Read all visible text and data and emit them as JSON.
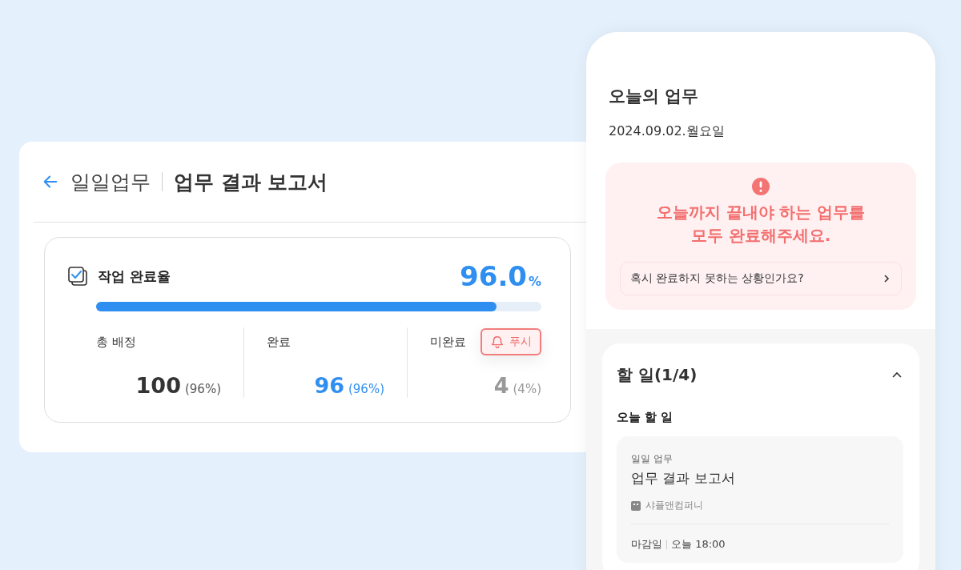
{
  "report": {
    "breadcrumb": "일일업무",
    "title": "업무 결과 보고서",
    "card": {
      "title": "작업 완료율",
      "percent": "96.0",
      "percent_unit": "%",
      "level": 0.9,
      "stats": [
        {
          "kind": "total",
          "label": "총 배정",
          "value": "100",
          "share": "(96%)"
        },
        {
          "kind": "done",
          "label": "완료",
          "value": "96",
          "share": "(96%)"
        },
        {
          "kind": "pending",
          "label": "미완료",
          "value": "4",
          "share": "(4%)",
          "button": "푸시"
        }
      ]
    }
  },
  "phone": {
    "title": "오늘의 업무",
    "date": "2024.09.02.월요일",
    "alert": {
      "lines": [
        "오늘까지 끝내야 하는 업무를",
        "모두 완료해주세요."
      ],
      "link": "혹시 완료하지 못하는 상황인가요?"
    },
    "todo": {
      "title": "할 일(1/4)",
      "expanded": true,
      "section": "오늘 할 일",
      "items": [
        {
          "category": "일일 업무",
          "title": "업무 결과 보고서",
          "company": "샤플앤컴퍼니",
          "due_label": "마감일",
          "due": "오늘 18:00"
        }
      ]
    }
  }
}
